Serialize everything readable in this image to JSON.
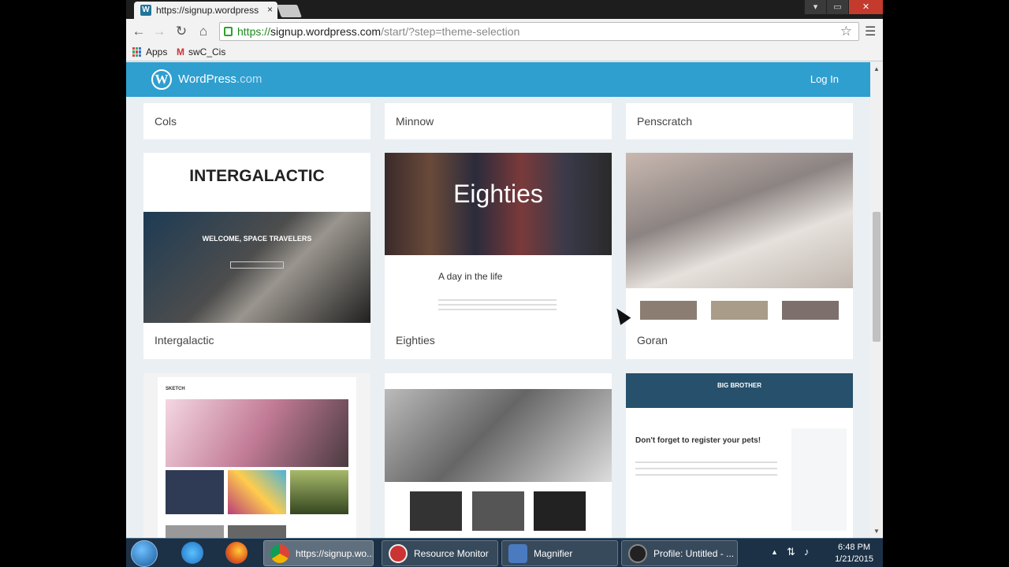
{
  "browser": {
    "tab_title": "https://signup.wordpress",
    "tab_close": "×",
    "favicon": "W",
    "url_scheme": "https://",
    "url_host": "signup.wordpress.com",
    "url_path": "/start/?step=theme-selection",
    "window_buttons": [
      "▾",
      "▭",
      "✕"
    ],
    "bookmarks": [
      {
        "label": "Apps",
        "icon": "apps-grid-icon"
      },
      {
        "label": "swC_Cis",
        "icon": "gmail-icon"
      }
    ]
  },
  "wp": {
    "logo_letter": "W",
    "brand": "WordPress",
    "brand_suffix": ".com",
    "login": "Log In"
  },
  "themes": {
    "row0": [
      "Cols",
      "Minnow",
      "Penscratch"
    ],
    "row1": [
      "Intergalactic",
      "Eighties",
      "Goran"
    ],
    "previews": {
      "intergalactic_title": "INTERGALACTIC",
      "intergalactic_welcome": "WELCOME, SPACE TRAVELERS",
      "eighties_title": "Eighties",
      "eighties_post": "A day in the life",
      "sketch_title": "SKETCH",
      "bigbrother_title": "BIG BROTHER",
      "bigbrother_post": "Don't forget to register your pets!"
    }
  },
  "taskbar": {
    "tasks": [
      "https://signup.wo...",
      "Resource Monitor",
      "Magnifier",
      "Profile: Untitled - ..."
    ],
    "time": "6:48 PM",
    "date": "1/21/2015"
  },
  "colors": {
    "wp_bar": "#2f9fcf",
    "taskbar": "#1c3146"
  }
}
